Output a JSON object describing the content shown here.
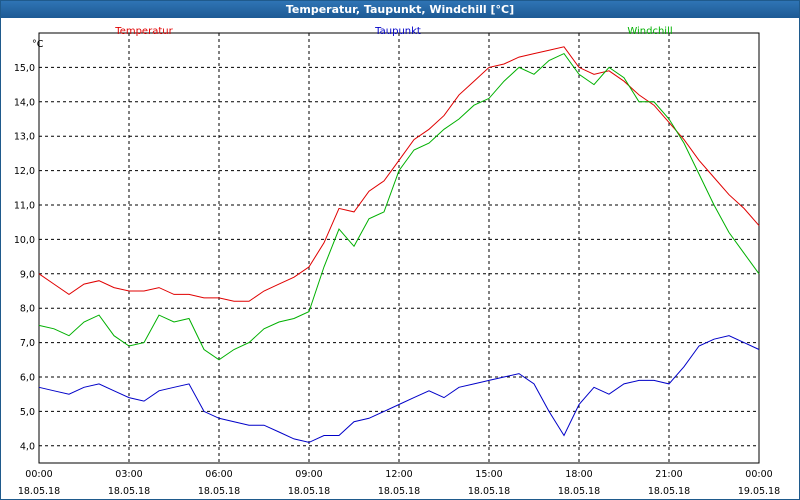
{
  "window": {
    "title": "Temperatur, Taupunkt, Windchill [°C]"
  },
  "chart_data": {
    "type": "line",
    "title": "Temperatur, Taupunkt, Windchill [°C]",
    "ylabel": "°C",
    "xlabel": "",
    "ylim": [
      3.5,
      16.0
    ],
    "xlim": [
      0,
      24
    ],
    "grid": true,
    "legend_position": "top",
    "y_ticks": [
      "4,0",
      "5,0",
      "6,0",
      "7,0",
      "8,0",
      "9,0",
      "10,0",
      "11,0",
      "12,0",
      "13,0",
      "14,0",
      "15,0"
    ],
    "x_ticks": [
      {
        "time": "00:00",
        "date": "18.05.18"
      },
      {
        "time": "03:00",
        "date": "18.05.18"
      },
      {
        "time": "06:00",
        "date": "18.05.18"
      },
      {
        "time": "09:00",
        "date": "18.05.18"
      },
      {
        "time": "12:00",
        "date": "18.05.18"
      },
      {
        "time": "15:00",
        "date": "18.05.18"
      },
      {
        "time": "18:00",
        "date": "18.05.18"
      },
      {
        "time": "21:00",
        "date": "18.05.18"
      },
      {
        "time": "00:00",
        "date": "19.05.18"
      }
    ],
    "x_hours": [
      0,
      0.5,
      1,
      1.5,
      2,
      2.5,
      3,
      3.5,
      4,
      4.5,
      5,
      5.5,
      6,
      6.5,
      7,
      7.5,
      8,
      8.5,
      9,
      9.5,
      10,
      10.5,
      11,
      11.5,
      12,
      12.5,
      13,
      13.5,
      14,
      14.5,
      15,
      15.5,
      16,
      16.5,
      17,
      17.5,
      18,
      18.5,
      19,
      19.5,
      20,
      20.5,
      21,
      21.5,
      22,
      22.5,
      23,
      23.5,
      24
    ],
    "series": [
      {
        "name": "Temperatur",
        "color": "#e00000",
        "values": [
          9.0,
          8.7,
          8.4,
          8.7,
          8.8,
          8.6,
          8.5,
          8.5,
          8.6,
          8.4,
          8.4,
          8.3,
          8.3,
          8.2,
          8.2,
          8.5,
          8.7,
          8.9,
          9.2,
          9.9,
          10.9,
          10.8,
          11.4,
          11.7,
          12.3,
          12.9,
          13.2,
          13.6,
          14.2,
          14.6,
          15.0,
          15.1,
          15.3,
          15.4,
          15.5,
          15.6,
          15.0,
          14.8,
          14.9,
          14.6,
          14.2,
          13.9,
          13.4,
          12.9,
          12.3,
          11.8,
          11.3,
          10.9,
          10.4
        ]
      },
      {
        "name": "Taupunkt",
        "color": "#0000c8",
        "values": [
          5.7,
          5.6,
          5.5,
          5.7,
          5.8,
          5.6,
          5.4,
          5.3,
          5.6,
          5.7,
          5.8,
          5.0,
          4.8,
          4.7,
          4.6,
          4.6,
          4.4,
          4.2,
          4.1,
          4.3,
          4.3,
          4.7,
          4.8,
          5.0,
          5.2,
          5.4,
          5.6,
          5.4,
          5.7,
          5.8,
          5.9,
          6.0,
          6.1,
          5.8,
          5.0,
          4.3,
          5.2,
          5.7,
          5.5,
          5.8,
          5.9,
          5.9,
          5.8,
          6.3,
          6.9,
          7.1,
          7.2,
          7.0,
          6.8
        ]
      },
      {
        "name": "Windchill",
        "color": "#00b000",
        "values": [
          7.5,
          7.4,
          7.2,
          7.6,
          7.8,
          7.2,
          6.9,
          7.0,
          7.8,
          7.6,
          7.7,
          6.8,
          6.5,
          6.8,
          7.0,
          7.4,
          7.6,
          7.7,
          7.9,
          9.2,
          10.3,
          9.8,
          10.6,
          10.8,
          12.0,
          12.6,
          12.8,
          13.2,
          13.5,
          13.9,
          14.1,
          14.6,
          15.0,
          14.8,
          15.2,
          15.4,
          14.8,
          14.5,
          15.0,
          14.7,
          14.0,
          14.0,
          13.5,
          12.8,
          11.9,
          11.0,
          10.2,
          9.6,
          9.0
        ]
      }
    ]
  }
}
